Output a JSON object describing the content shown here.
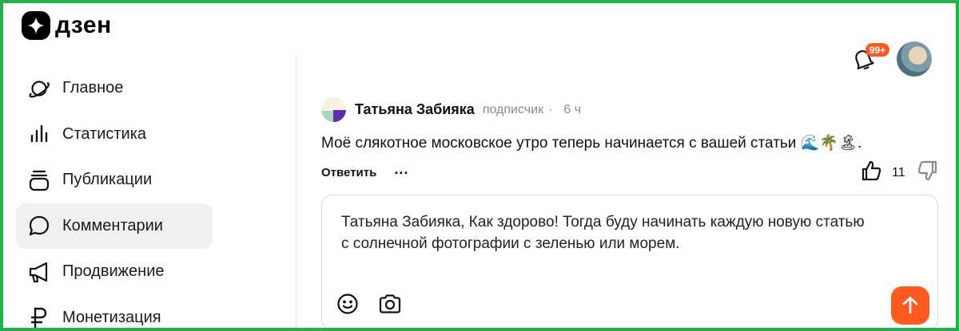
{
  "app": {
    "logo_text": "дзен",
    "brand_color": "#000000",
    "accent": "#ff5a1f"
  },
  "sidebar": {
    "items": [
      {
        "label": "Главное",
        "icon": "planet-icon",
        "active": false
      },
      {
        "label": "Статистика",
        "icon": "bar-chart-icon",
        "active": false
      },
      {
        "label": "Публикации",
        "icon": "stack-icon",
        "active": false
      },
      {
        "label": "Комментарии",
        "icon": "comment-bubble-icon",
        "active": true
      },
      {
        "label": "Продвижение",
        "icon": "megaphone-icon",
        "active": false
      },
      {
        "label": "Монетизация",
        "icon": "ruble-icon",
        "active": false
      }
    ]
  },
  "header": {
    "notifications_badge": "99+",
    "bell_icon": "bell-icon",
    "avatar": "user-avatar"
  },
  "comment": {
    "author": "Татьяна Забияка",
    "role": "подписчик",
    "separator": "·",
    "time": "6 ч",
    "text": "Моё слякотное московское утро теперь начинается с вашей статьи 🌊🌴🏝.",
    "reply_label": "Ответить",
    "more_label": "···",
    "likes": "11"
  },
  "reply": {
    "text": "Татьяна Забияка, Как здорово! Тогда буду начинать каждую новую статью\nс солнечной фотографии с зеленью или морем."
  }
}
